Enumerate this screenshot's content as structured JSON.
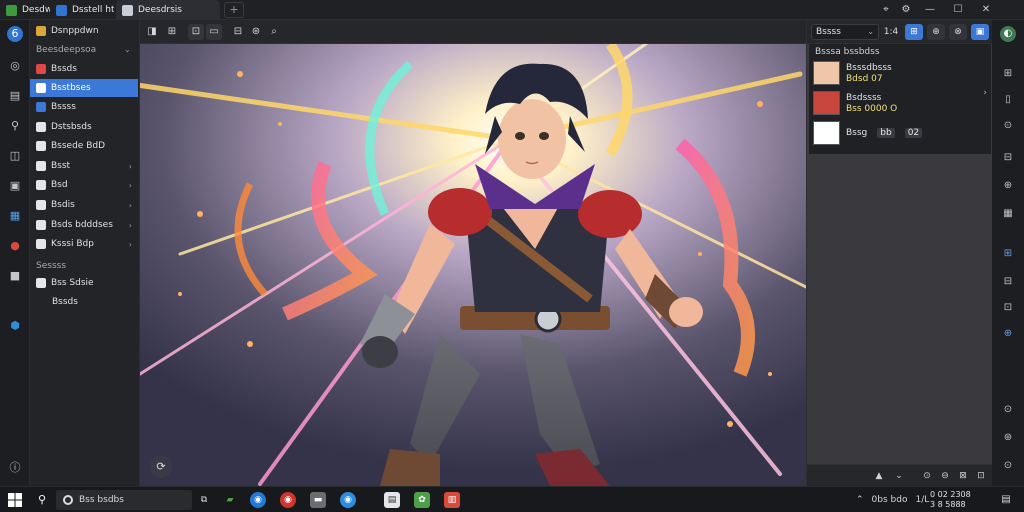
{
  "tabs": [
    {
      "label": "Desdw",
      "color": "#3f9a3e"
    },
    {
      "label": "Dsstell htm",
      "color": "#2f74d0"
    },
    {
      "label": "Deesdrsis",
      "color": "#c9cdd6"
    }
  ],
  "new_tab_glyph": "+",
  "window_controls": {
    "pin": "⌖",
    "settings": "⚙",
    "minimize": "—",
    "maximize": "☐",
    "close": "✕"
  },
  "rail_icons": [
    "6",
    "◎",
    "▤",
    "⚲",
    "◫",
    "▣",
    "▦",
    "●",
    "■",
    "⬢",
    "ⓘ"
  ],
  "sidebar": {
    "top_item": {
      "label": "Dsnppdwn",
      "icon_color": "#d8a83a"
    },
    "section1": "Beesdeepsoa",
    "items": [
      {
        "label": "Bssds",
        "icon_color": "#e04848",
        "chevron": false,
        "active": false
      },
      {
        "label": "Bsstbses",
        "icon_color": "#ffffff",
        "chevron": false,
        "active": true
      },
      {
        "label": "Bssss",
        "icon_color": "#3b78d8",
        "chevron": false,
        "active": false
      },
      {
        "label": "Dstsbsds",
        "icon_color": "#e6e6e9",
        "chevron": false,
        "active": false
      },
      {
        "label": "Bssede BdD",
        "icon_color": "#e6e6e9",
        "chevron": false,
        "active": false
      },
      {
        "label": "Bsst",
        "icon_color": "#e6e6e9",
        "chevron": true,
        "active": false
      },
      {
        "label": "Bsd",
        "icon_color": "#e6e6e9",
        "chevron": true,
        "active": false
      },
      {
        "label": "Bsdis",
        "icon_color": "#e6e6e9",
        "chevron": true,
        "active": false
      },
      {
        "label": "Bsds bdddses",
        "icon_color": "#e6e6e9",
        "chevron": true,
        "active": false
      },
      {
        "label": "Ksssi Bdp",
        "icon_color": "#e6e6e9",
        "chevron": true,
        "active": false
      }
    ],
    "section2": "Sessss",
    "items2": [
      {
        "label": "Bss Sdsie",
        "icon_color": "#e6e6e9"
      },
      {
        "label": "Bssds",
        "icon_color": ""
      }
    ]
  },
  "toolbar_icons": [
    "◨",
    "⊞",
    "⊡",
    "▭",
    "⊟",
    "⊛",
    "⌕"
  ],
  "right_panel": {
    "select_value": "Bssss",
    "zoom_value": "1:4",
    "buttons": [
      "⊞",
      "⊕",
      "⊗",
      "▣"
    ],
    "layers_title": "Bsssa bssbdss",
    "layers": [
      {
        "name": "Bsssdbsss",
        "sub": "Bdsd 07",
        "thumb": "#f0c6a8"
      },
      {
        "name": "Bsdssss",
        "sub": "Bss 0000 O",
        "thumb": "#c8463e"
      },
      {
        "name": "Bssg",
        "sub": "",
        "thumb": "#ffffff"
      }
    ],
    "layer_badges": [
      "bb",
      "02"
    ],
    "bottom_icons": [
      "▲",
      "⌄",
      "⊙",
      "⊖",
      "⊠",
      "⊡"
    ]
  },
  "right_rail_icons": [
    "◐",
    "⊞",
    "▯",
    "⊙",
    "⊟",
    "⊕",
    "▦",
    "⊞",
    "⊟",
    "⊡",
    "⊕",
    "⊙",
    "⊛",
    "⊙"
  ],
  "taskbar": {
    "search_placeholder": "Bss bsdbs",
    "app_icons": [
      {
        "glyph": "⧉",
        "color": "#2a2b2f"
      },
      {
        "glyph": "▰",
        "color": "#3f9a3e"
      },
      {
        "glyph": "◉",
        "color": "#1f7ad8"
      },
      {
        "glyph": "◉",
        "color": "#d0352c"
      },
      {
        "glyph": "▬",
        "color": "#6b6d73"
      },
      {
        "glyph": "◉",
        "color": "#2a8de0"
      },
      {
        "glyph": "▤",
        "color": "#e6e6e9"
      },
      {
        "glyph": "✿",
        "color": "#4da04a"
      },
      {
        "glyph": "▥",
        "color": "#d84a3a"
      }
    ],
    "tray_text": "0bs bdo",
    "tray_num": "1/L",
    "clock_line1": "0 02 2308",
    "clock_line2": "3 8 5888"
  }
}
